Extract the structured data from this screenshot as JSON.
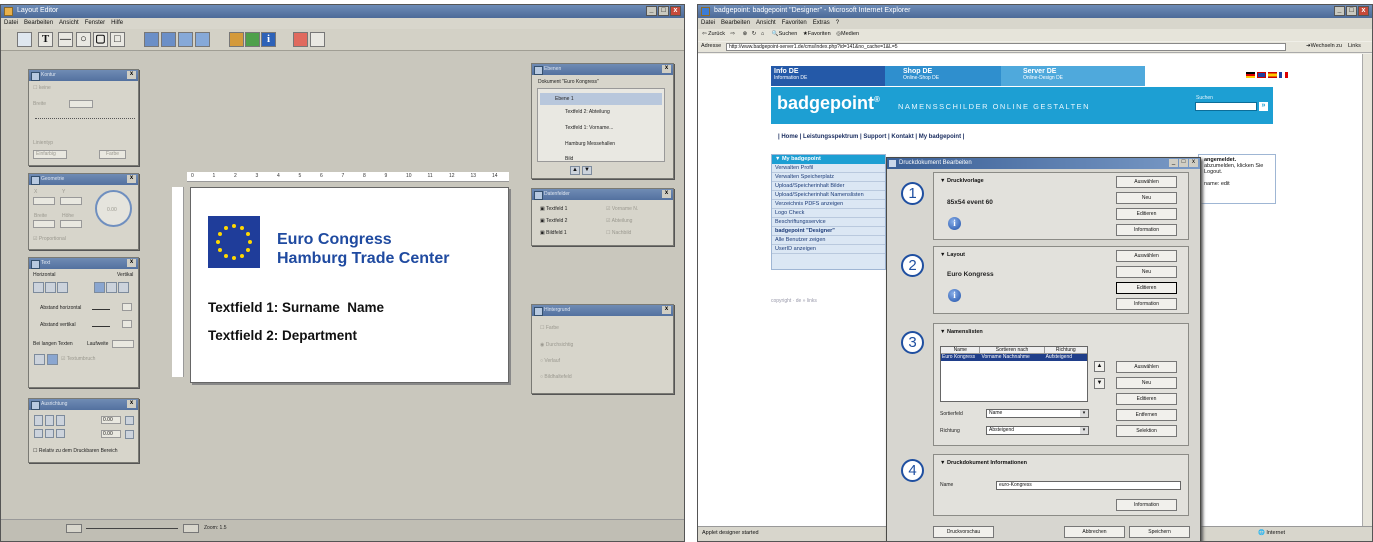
{
  "layout_editor": {
    "title": "Layout Editor",
    "menu": [
      "Datei",
      "Bearbeiten",
      "Ansicht",
      "Fenster",
      "Hilfe"
    ],
    "toolbar_text_icon": "T",
    "palettes": {
      "kontur": {
        "title": "Kontur",
        "none_label": "keine",
        "breite_label": "Breite",
        "linientyp_label": "Linientyp",
        "linientyp_value": "Einfarbig",
        "farbe_button": "Farbe"
      },
      "geometrie": {
        "title": "Geometrie",
        "x_label": "X",
        "y_label": "Y",
        "breite_label": "Breite",
        "hoehe_label": "Höhe",
        "angle_value": "0.00",
        "proportional_label": "Proportional"
      },
      "text": {
        "title": "Text",
        "horizontal_label": "Horizontal",
        "vertikal_label": "Vertikal",
        "abstand_h_label": "Abstand horizontal",
        "abstand_v_label": "Abstand vertikal",
        "bei_langen_label": "Bei langen Texten",
        "laufweite_label": "Laufweite",
        "textumbruch_label": "Textumbruch"
      },
      "ausrichtung": {
        "title": "Ausrichtung",
        "value1": "0.00",
        "value2": "0.00",
        "relativ_label": "Relativ zu dem Druckbaren Bereich"
      },
      "ebenen": {
        "title": "Ebenen",
        "document_label": "Dokument \"Euro Kongress\"",
        "items": [
          "Ebene 1",
          "Textfeld 2: Abteilung",
          "Textfeld 1: Vorname...",
          "Hamburg Messehallen",
          "Bild"
        ]
      },
      "datenfelder": {
        "title": "Datenfelder",
        "items": [
          "Textfeld 1",
          "Textfeld 2",
          "Bildfeld 1"
        ],
        "checks": [
          "Vorname N.",
          "Abteilung",
          "Nachbild"
        ]
      },
      "hintergrund": {
        "title": "Hintergrund",
        "options": [
          "Farbe",
          "Durchsichtig",
          "Verlauf",
          "Bildhaltefeld"
        ]
      }
    },
    "canvas": {
      "line1": "Euro Congress",
      "line2": "Hamburg Trade Center",
      "field1": "Textfield 1: Surname  Name",
      "field2": "Textfield 2: Department"
    },
    "ruler_numbers": [
      "0",
      "1",
      "2",
      "3",
      "4",
      "5",
      "6",
      "7",
      "8",
      "9",
      "10",
      "11",
      "12",
      "13",
      "14"
    ],
    "status": {
      "zoom": "Zoom: 1.5"
    }
  },
  "browser": {
    "title": "badgepoint: badgepoint \"Designer\" - Microsoft Internet Explorer",
    "menu": [
      "Datei",
      "Bearbeiten",
      "Ansicht",
      "Favoriten",
      "Extras",
      "?"
    ],
    "toolbar": {
      "back": "Zurück",
      "search": "Suchen",
      "favorites": "Favoriten",
      "media": "Medien"
    },
    "address_label": "Adresse",
    "address": "http://www.badgepoint-server1.de/cms/index.php?id=141&no_cache=1&L=5",
    "go_label": "Wechseln zu",
    "links_label": "Links",
    "status_left": "Applet designer started",
    "status_right": "Internet",
    "site": {
      "tabs": [
        {
          "title": "Info DE",
          "sub": "Information DE"
        },
        {
          "title": "Shop DE",
          "sub": "Online-Shop DE"
        },
        {
          "title": "Server DE",
          "sub": "Online-Design DE"
        }
      ],
      "logo": "badgepoint",
      "logo_reg": "®",
      "tagline": "NAMENSSCHILDER ONLINE GESTALTEN",
      "search_label": "Suchen",
      "search_go": "»",
      "nav": "| Home | Leistungsspektrum | Support | Kontakt | My badgepoint |",
      "sidebar_header": "▼ My badgepoint",
      "sidebar_items": [
        "Verwalten Profil",
        "Verwalten Speicherplatz",
        "Upload/Speicherinhalt Bilder",
        "Upload/Speicherinhalt Namenslisten",
        "Verzeichnis PDFS anzeigen",
        "Logo Check",
        "Beschriftungsservice",
        "badgepoint \"Designer\"",
        "Alle Benutzer zeigen",
        "UserID anzeigen"
      ],
      "copyright": "copyright · de » links",
      "login_title": "angemeldet.",
      "login_text1": "abzumelden, klicken Sie",
      "login_text2": "Logout.",
      "login_text3": "name: edit"
    }
  },
  "dialog": {
    "title": "Druckdokument Bearbeiten",
    "groups": [
      {
        "num": "1",
        "title": "Drucklvorlage",
        "value": "85x54 event 60",
        "buttons": [
          "Auswählen",
          "Neu",
          "Editieren",
          "Information"
        ]
      },
      {
        "num": "2",
        "title": "Layout",
        "value": "Euro Kongress",
        "buttons": [
          "Auswählen",
          "Neu",
          "Editieren",
          "Information"
        ]
      },
      {
        "num": "3",
        "title": "Namenslisten",
        "table_headers": [
          "Name",
          "Sortieren nach",
          "Richtung"
        ],
        "table_row": [
          "Euro Kongress",
          "Vorname Nachnahme",
          "Aufsteigend"
        ],
        "buttons": [
          "Auswählen",
          "Neu",
          "Editieren",
          "Entfernen",
          "Selektion"
        ],
        "sortierfeld_label": "Sortierfeld",
        "sortierfeld_value": "Name",
        "richtung_label": "Richtung",
        "richtung_value": "Absteigend"
      },
      {
        "num": "4",
        "title": "Druckdokument Informationen",
        "name_label": "Name",
        "name_value": "euro-Kongress",
        "buttons": [
          "Information"
        ]
      }
    ],
    "footer": {
      "preview": "Druckvorschau",
      "cancel": "Abbrechen",
      "save": "Speichern"
    }
  },
  "colors": {
    "site_blue": "#1d9fd3",
    "dialog_blue": "#1f4fa0",
    "xp_title": "#4c6a98"
  }
}
